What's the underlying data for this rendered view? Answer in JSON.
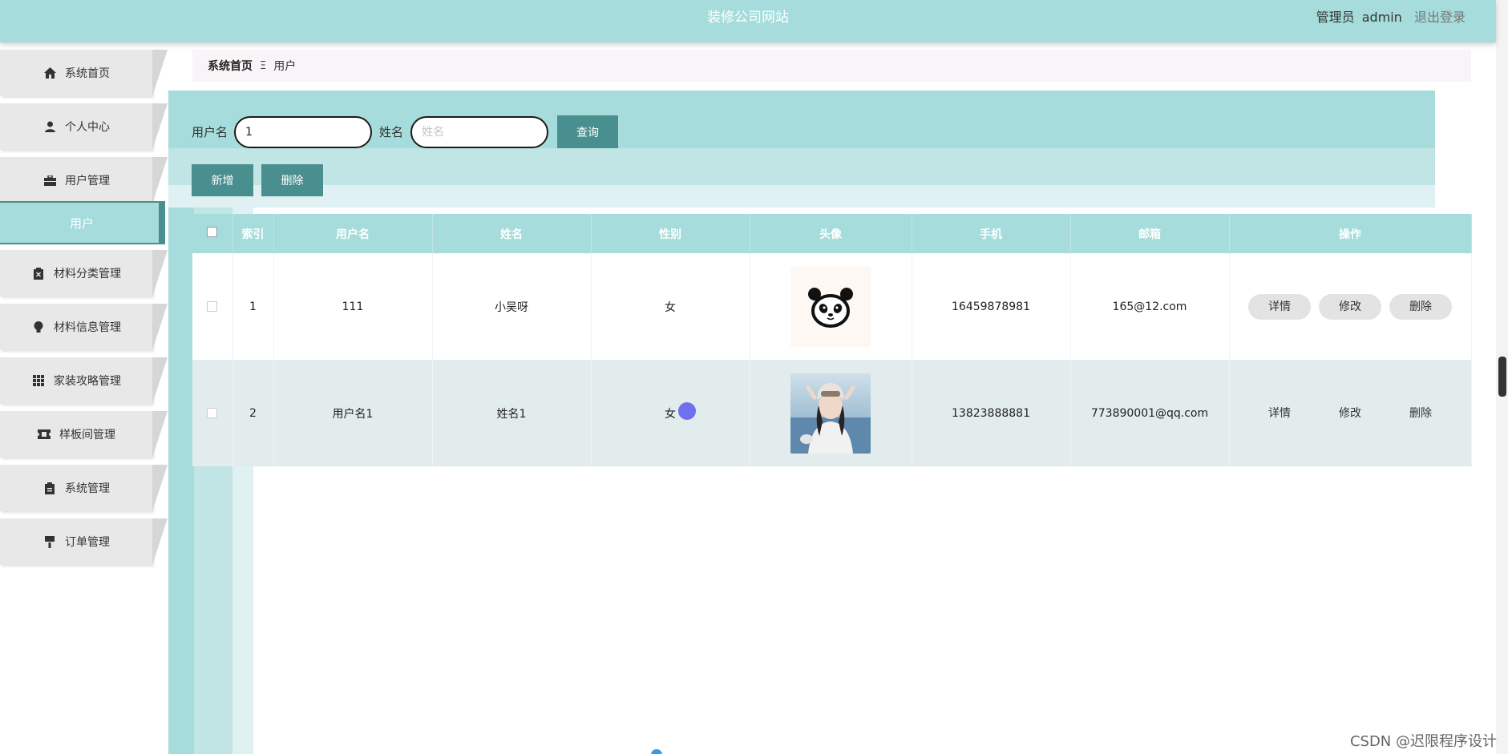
{
  "header": {
    "title": "装修公司网站",
    "role": "管理员",
    "username": "admin",
    "logout": "退出登录"
  },
  "sidebar": {
    "items": [
      {
        "label": "系统首页",
        "icon": "home-icon"
      },
      {
        "label": "个人中心",
        "icon": "person-icon"
      },
      {
        "label": "用户管理",
        "icon": "briefcase-icon"
      },
      {
        "label": "材料分类管理",
        "icon": "clipboard-x-icon"
      },
      {
        "label": "材料信息管理",
        "icon": "bulb-icon"
      },
      {
        "label": "家装攻略管理",
        "icon": "grid-icon"
      },
      {
        "label": "样板间管理",
        "icon": "ticket-icon"
      },
      {
        "label": "系统管理",
        "icon": "clipboard-icon"
      },
      {
        "label": "订单管理",
        "icon": "brush-icon"
      }
    ],
    "sub_item": "用户"
  },
  "breadcrumb": {
    "home": "系统首页",
    "separator": "Ξ",
    "current": "用户"
  },
  "search": {
    "username_label": "用户名",
    "username_value": "1",
    "name_label": "姓名",
    "name_placeholder": "姓名",
    "query_button": "查询"
  },
  "actions": {
    "add": "新增",
    "delete": "删除"
  },
  "table": {
    "columns": [
      "索引",
      "用户名",
      "姓名",
      "性别",
      "头像",
      "手机",
      "邮箱",
      "操作"
    ],
    "rows": [
      {
        "index": "1",
        "username": "111",
        "name": "小吴呀",
        "gender": "女",
        "avatar": "panda-avatar",
        "phone": "16459878981",
        "email": "165@12.com"
      },
      {
        "index": "2",
        "username": "用户名1",
        "name": "姓名1",
        "gender": "女",
        "avatar": "photo-avatar",
        "phone": "13823888881",
        "email": "773890001@qq.com"
      }
    ],
    "op_labels": {
      "detail": "详情",
      "edit": "修改",
      "delete": "删除"
    }
  },
  "watermark": "CSDN @迟限程序设计",
  "colors": {
    "accent": "#a6dcdc",
    "button_dark": "#4a8f8f",
    "menu_bg": "#e8e8e8"
  }
}
